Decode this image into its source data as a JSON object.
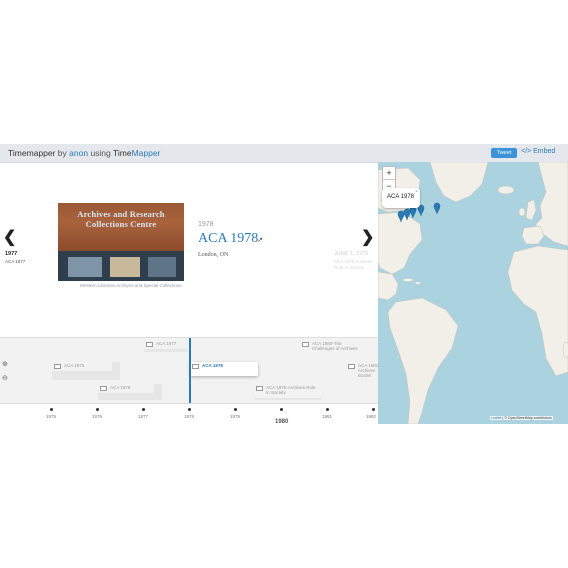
{
  "header": {
    "app_name": "Timemapper",
    "by_text": "by",
    "author": "anon",
    "using_text": "using",
    "tool_part1": "Time",
    "tool_part2": "Mapper",
    "tweet_label": "Tweet",
    "embed_label": "</> Embed"
  },
  "story": {
    "prev": {
      "year": "1977",
      "title": "ACA 1977",
      "arrow": "❮"
    },
    "photo": {
      "sign_text": "Archives and Research Collections Centre",
      "caption": "Western Libraries Archives and Special Collections"
    },
    "current": {
      "year": "1978",
      "title": "ACA 1978",
      "location": "London, ON"
    },
    "next": {
      "date": "JUNE 1, 1979",
      "title": "ACA 1979 Archives Role In Society",
      "arrow": "❯"
    }
  },
  "map": {
    "zoom_in": "+",
    "zoom_out": "−",
    "popup_title": "ACA 1978",
    "popup_close": "×",
    "attribution_leaflet": "Leaflet",
    "attribution_osm": "© OpenStreetMap contributors",
    "colors": {
      "water": "#aad3df",
      "land": "#f2efe9",
      "marker": "#2a7ab7"
    }
  },
  "timeline": {
    "zoom_in_icon": "⊕",
    "zoom_out_icon": "⊖",
    "events": [
      {
        "title": "ACA 1977"
      },
      {
        "title": "ACA 1975"
      },
      {
        "title": "ACA 1976"
      },
      {
        "title": "ACA 1978"
      },
      {
        "title": "ACA 1979-Archives Role In Society"
      },
      {
        "title": "ACA 1980-The Challenges of Archives"
      },
      {
        "title": "ACA 1981 Archives Border"
      }
    ],
    "ticks": [
      "1975",
      "1976",
      "1977",
      "1978",
      "1979",
      "1980",
      "1981",
      "1982"
    ],
    "major_label": "1980"
  }
}
